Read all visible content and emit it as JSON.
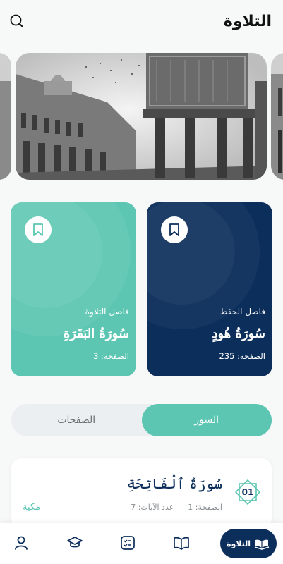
{
  "header": {
    "title": "التلاوة",
    "search_icon": "search-icon"
  },
  "carousel": {
    "slides": [
      "mosque-photo-left",
      "mosque-photo-main",
      "mosque-photo-right"
    ]
  },
  "bookmarks": [
    {
      "label": "فاصل الحفظ",
      "surah": "سُورَةُ هُودٍ",
      "page": "الصفحة: 235",
      "color": "#0c2e5b"
    },
    {
      "label": "فاصل التلاوة",
      "surah": "سُورَةُ البَقَرَةِ",
      "page": "الصفحة: 3",
      "color": "#5cc6b2"
    }
  ],
  "tabs": {
    "surahs": "السور",
    "pages": "الصفحات",
    "active": "surahs"
  },
  "surah_list": [
    {
      "number": "01",
      "name": "سُورَةُ ٱلْفَاتِحَةِ",
      "page": "الصفحة: 1",
      "ayat": "عدد الآيات: 7",
      "type": "مكية"
    }
  ],
  "bottom_nav": {
    "active_label": "التلاوة",
    "items": [
      "profile-icon",
      "graduation-cap-icon",
      "checklist-icon",
      "book-icon",
      "quran-icon"
    ]
  },
  "colors": {
    "teal": "#5cc6b2",
    "navy": "#0c2e5b"
  }
}
